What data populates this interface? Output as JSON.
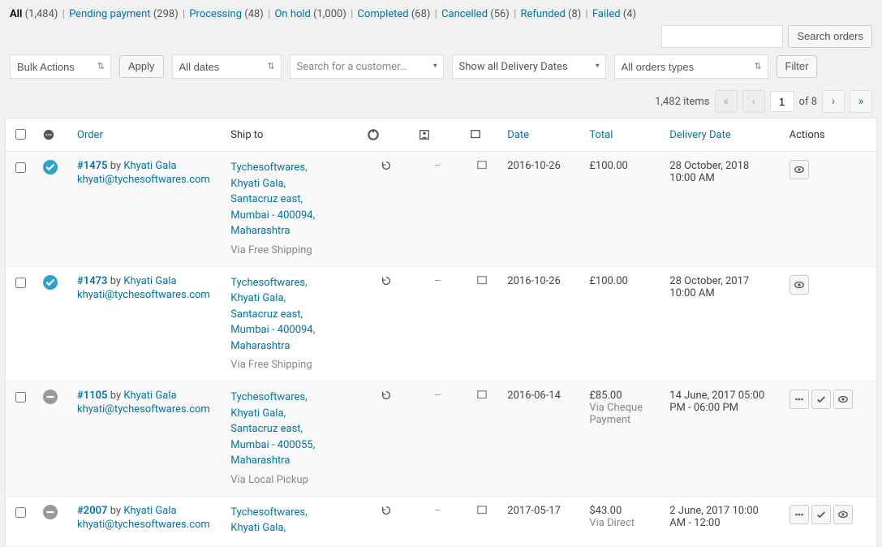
{
  "status_filters": [
    {
      "label": "All",
      "count": "(1,484)",
      "active": true
    },
    {
      "label": "Pending payment",
      "count": "(298)"
    },
    {
      "label": "Processing",
      "count": "(48)"
    },
    {
      "label": "On hold",
      "count": "(1,000)"
    },
    {
      "label": "Completed",
      "count": "(68)"
    },
    {
      "label": "Cancelled",
      "count": "(56)"
    },
    {
      "label": "Refunded",
      "count": "(8)"
    },
    {
      "label": "Failed",
      "count": "(4)"
    }
  ],
  "search": {
    "placeholder": "",
    "button": "Search orders"
  },
  "filters": {
    "bulk_action": "Bulk Actions",
    "apply": "Apply",
    "dates": "All dates",
    "customer_placeholder": "Search for a customer…",
    "delivery_dates": "Show all Delivery Dates",
    "order_types": "All orders types",
    "filter": "Filter"
  },
  "pagination": {
    "items_text": "1,482 items",
    "page": "1",
    "of_text": "of 8"
  },
  "columns": {
    "order": "Order",
    "ship_to": "Ship to",
    "date": "Date",
    "total": "Total",
    "delivery_date": "Delivery Date",
    "actions": "Actions"
  },
  "rows": [
    {
      "status": "processing",
      "id": "#1475",
      "by": "by",
      "customer": "Khyati Gala",
      "email": "khyati@tychesoftwares.com",
      "ship": "Tychesoftwares, Khyati Gala, Santacruz east, Mumbai - 400094, Maharashtra",
      "via": "Via Free Shipping",
      "c1": "refresh",
      "c2": "–",
      "c3": "note",
      "date": "2016-10-26",
      "total": "£100.00",
      "total_note": "",
      "delivery": "28 October, 2018 10:00 AM",
      "actions": [
        "view"
      ]
    },
    {
      "status": "processing",
      "id": "#1473",
      "by": "by",
      "customer": "Khyati Gala",
      "email": "khyati@tychesoftwares.com",
      "ship": "Tychesoftwares, Khyati Gala, Santacruz east, Mumbai - 400094, Maharashtra",
      "via": "Via Free Shipping",
      "c1": "refresh",
      "c2": "–",
      "c3": "note",
      "date": "2016-10-26",
      "total": "£100.00",
      "total_note": "",
      "delivery": "28 October, 2017 10:00 AM",
      "actions": [
        "view"
      ]
    },
    {
      "status": "cancelled",
      "id": "#1105",
      "by": "by",
      "customer": "Khyati Gala",
      "email": "khyati@tychesoftwares.com",
      "ship": "Tychesoftwares, Khyati Gala, Santacruz east, Mumbai - 400055, Maharashtra",
      "via": "Via Local Pickup",
      "c1": "refresh",
      "c2": "–",
      "c3": "note",
      "date": "2016-06-14",
      "total": "£85.00",
      "total_note": "Via Cheque Payment",
      "delivery": "14 June, 2017 05:00 PM - 06:00 PM",
      "actions": [
        "more",
        "complete",
        "view"
      ]
    },
    {
      "status": "cancelled",
      "id": "#2007",
      "by": "by",
      "customer": "Khyati Gala",
      "email": "khyati@tychesoftwares.com",
      "ship": "Tychesoftwares, Khyati Gala,",
      "via": "",
      "c1": "refresh",
      "c2": "–",
      "c3": "note",
      "date": "2017-05-17",
      "total": "$43.00",
      "total_note": "Via Direct",
      "delivery": "2 June, 2017 10:00 AM - 12:00",
      "actions": [
        "more",
        "complete",
        "view"
      ]
    }
  ]
}
